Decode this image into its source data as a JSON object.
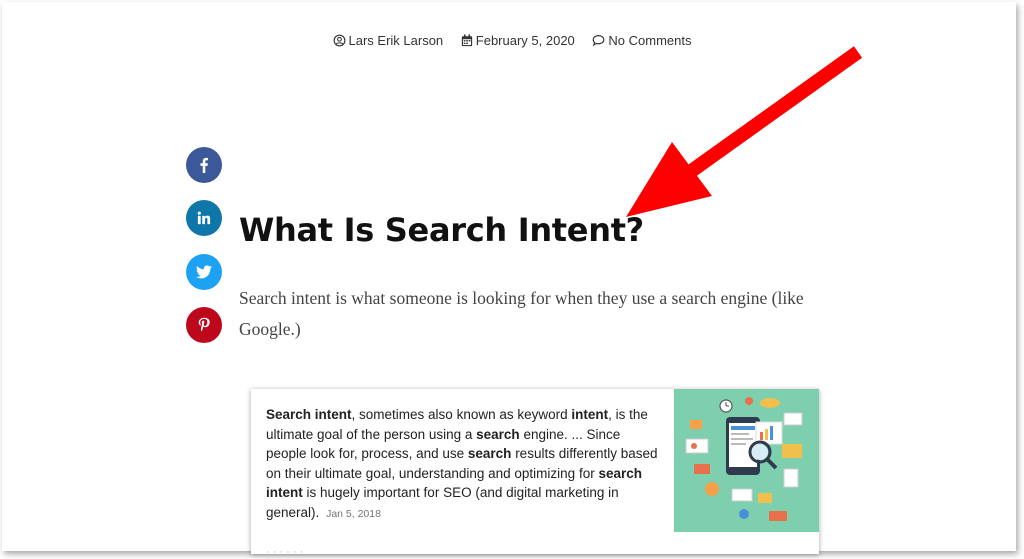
{
  "meta": {
    "author": "Lars Erik Larson",
    "date": "February 5, 2020",
    "comments": "No Comments",
    "icons": {
      "author": "user-circle-icon",
      "date": "calendar-icon",
      "comments": "comment-icon"
    }
  },
  "share": [
    {
      "name": "facebook",
      "color": "#3b5998",
      "icon": "facebook-icon"
    },
    {
      "name": "linkedin",
      "color": "#0e76a8",
      "icon": "linkedin-icon"
    },
    {
      "name": "twitter",
      "color": "#1da1f2",
      "icon": "twitter-icon"
    },
    {
      "name": "pinterest",
      "color": "#bd081c",
      "icon": "pinterest-icon"
    }
  ],
  "article": {
    "title": "What Is Search Intent?",
    "intro": "Search intent is what someone is looking for when they use a search engine (like Google.)"
  },
  "snippet": {
    "segments": [
      {
        "text": "Search intent",
        "bold": true
      },
      {
        "text": ", sometimes also known as keyword ",
        "bold": false
      },
      {
        "text": "intent",
        "bold": true
      },
      {
        "text": ", is the ultimate goal of the person using a ",
        "bold": false
      },
      {
        "text": "search",
        "bold": true
      },
      {
        "text": " engine. ... Since people look for, process, and use ",
        "bold": false
      },
      {
        "text": "search",
        "bold": true
      },
      {
        "text": " results differently based on their ultimate goal, understanding and optimizing for ",
        "bold": false
      },
      {
        "text": "search intent",
        "bold": true
      },
      {
        "text": " is hugely important for SEO (and digital marketing in general).",
        "bold": false
      }
    ],
    "date": "Jan 5, 2018",
    "image_bg": "#7ecfae"
  },
  "annotation": {
    "arrow_color": "#ff0000"
  }
}
